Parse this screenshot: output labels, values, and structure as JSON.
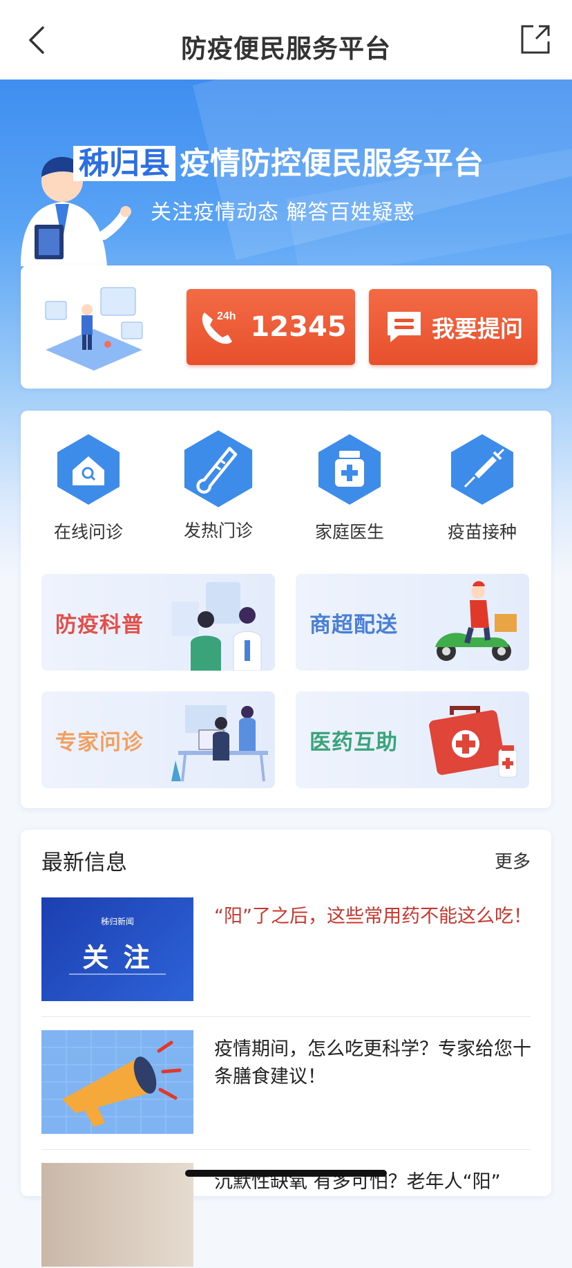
{
  "header": {
    "title": "防疫便民服务平台"
  },
  "hero": {
    "county": "秭归县",
    "title_rest": "疫情防控便民服务平台",
    "subtitle": "关注疫情动态 解答百姓疑惑"
  },
  "hotline": {
    "badge": "24h",
    "number": "12345",
    "ask_label": "我要提问"
  },
  "services": [
    {
      "label": "在线问诊",
      "icon": "house-search-icon"
    },
    {
      "label": "发热门诊",
      "icon": "thermometer-icon"
    },
    {
      "label": "家庭医生",
      "icon": "medicine-bottle-icon"
    },
    {
      "label": "疫苗接种",
      "icon": "syringe-icon"
    }
  ],
  "tiles": [
    {
      "label": "防疫科普",
      "color": "#e0514b"
    },
    {
      "label": "商超配送",
      "color": "#4a7fd6"
    },
    {
      "label": "专家问诊",
      "color": "#f0a060"
    },
    {
      "label": "医药互助",
      "color": "#3aa37a"
    }
  ],
  "news": {
    "heading": "最新信息",
    "more": "更多",
    "items": [
      {
        "title": "“阳”了之后，这些常用药不能这么吃！",
        "thumb_caption": "关 注",
        "thumb_brand": "秭归新闻",
        "highlight": true
      },
      {
        "title": "疫情期间，怎么吃更科学？专家给您十条膳食建议！",
        "highlight": false
      },
      {
        "title": "沉默性缺氧 有多可怕？老年人“阳”",
        "highlight": false
      }
    ]
  },
  "colors": {
    "accent_blue": "#3f8ef0",
    "orange": "#e8542f",
    "headline_red": "#c8372e"
  }
}
